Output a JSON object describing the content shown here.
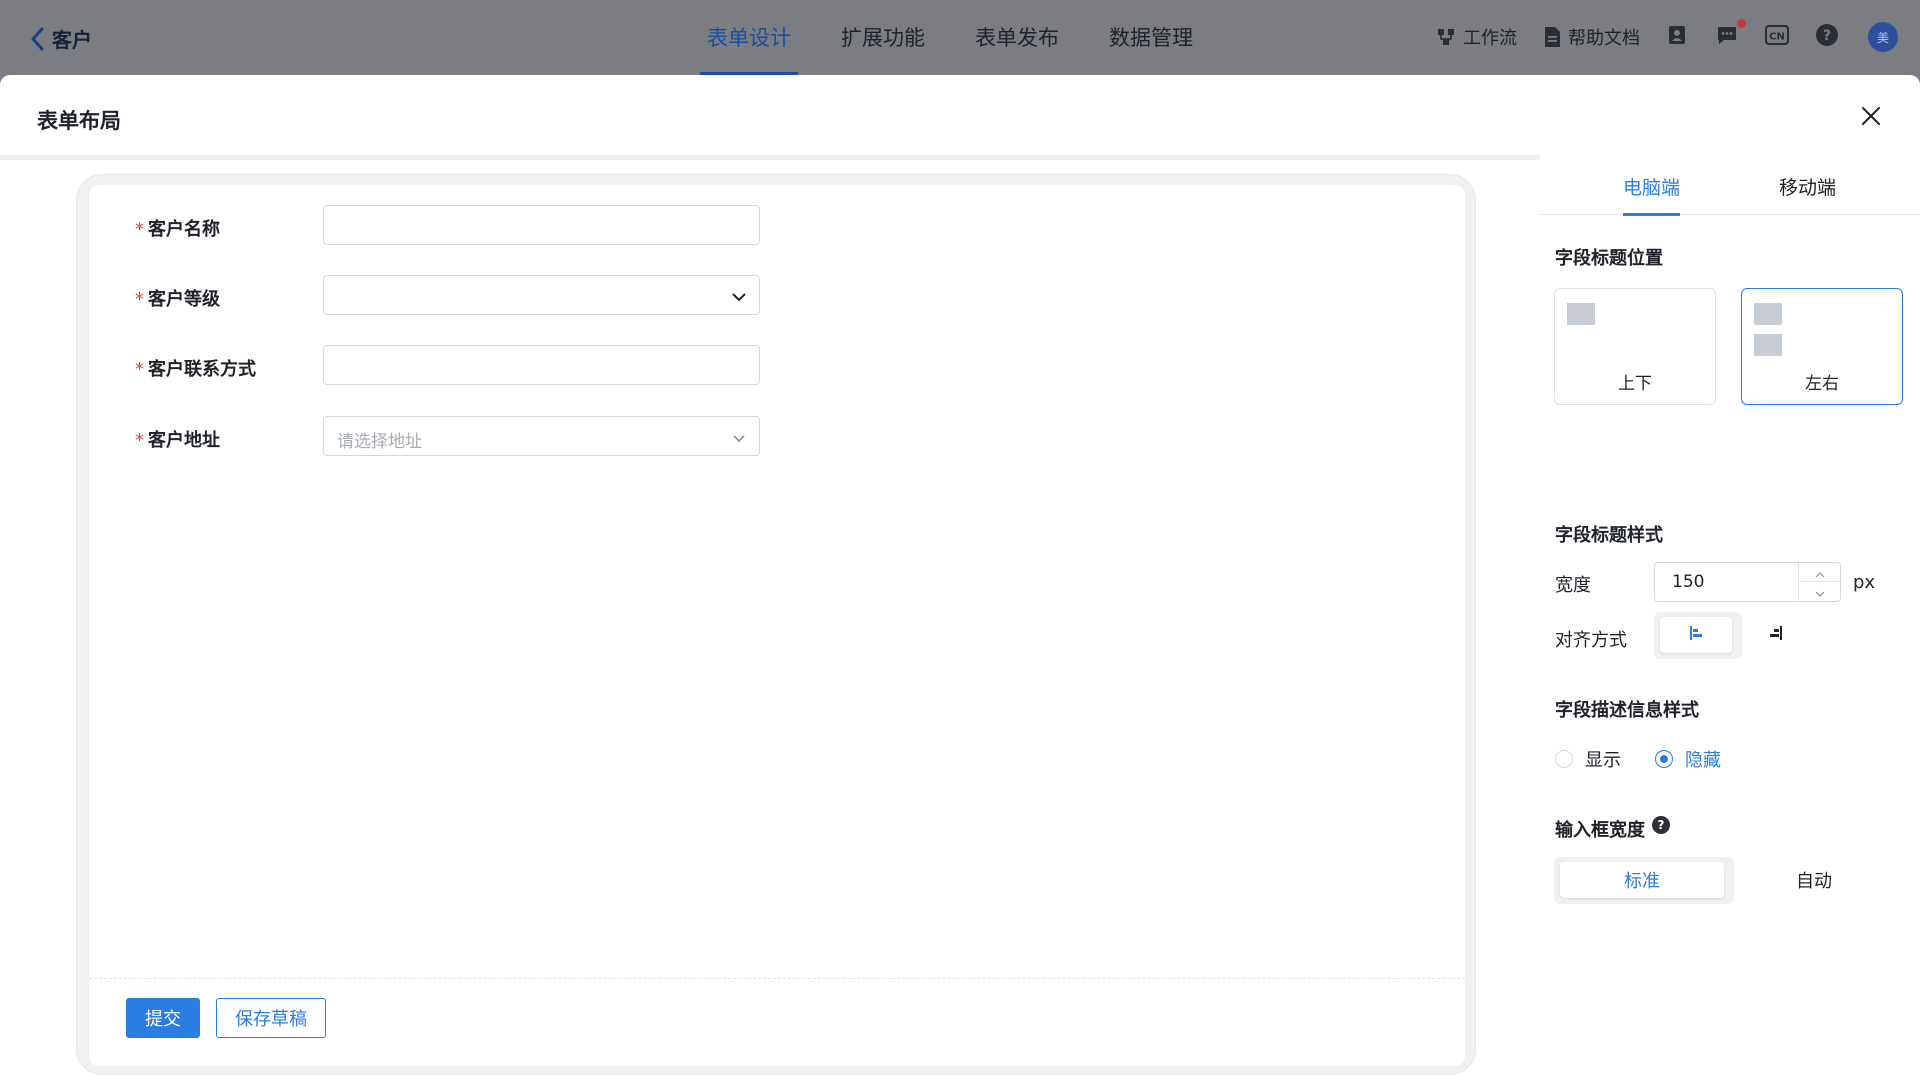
{
  "header": {
    "back_label": "客户",
    "tabs": [
      "表单设计",
      "扩展功能",
      "表单发布",
      "数据管理"
    ],
    "active_tab": "表单设计",
    "tools": {
      "workflow": "工作流",
      "help_docs": "帮助文档"
    },
    "avatar_text": "美"
  },
  "drawer": {
    "title": "表单布局"
  },
  "form": {
    "fields": [
      {
        "label": "客户名称",
        "required": "*",
        "type": "text",
        "value": ""
      },
      {
        "label": "客户等级",
        "required": "*",
        "type": "select",
        "value": ""
      },
      {
        "label": "客户联系方式",
        "required": "*",
        "type": "text",
        "value": ""
      },
      {
        "label": "客户地址",
        "required": "*",
        "type": "address",
        "placeholder": "请选择地址"
      }
    ],
    "submit_label": "提交",
    "draft_label": "保存草稿"
  },
  "panel": {
    "tabs": [
      "电脑端",
      "移动端"
    ],
    "active_tab": "电脑端",
    "label_position": {
      "title": "字段标题位置",
      "options": [
        "上下",
        "左右"
      ],
      "selected": "左右"
    },
    "label_style": {
      "title": "字段标题样式",
      "width_label": "宽度",
      "width_value": "150",
      "width_unit": "px",
      "align_label": "对齐方式",
      "align_selected": "left"
    },
    "description_style": {
      "title": "字段描述信息样式",
      "options": [
        "显示",
        "隐藏"
      ],
      "selected": "隐藏"
    },
    "input_width": {
      "title": "输入框宽度",
      "help_icon": "?",
      "options": [
        "标准",
        "自动"
      ],
      "selected": "标准"
    }
  },
  "colors": {
    "accent": "#2b7de2",
    "header_active": "#1a4fa1",
    "required": "#e0413c",
    "overlay": "#7b7d82"
  }
}
